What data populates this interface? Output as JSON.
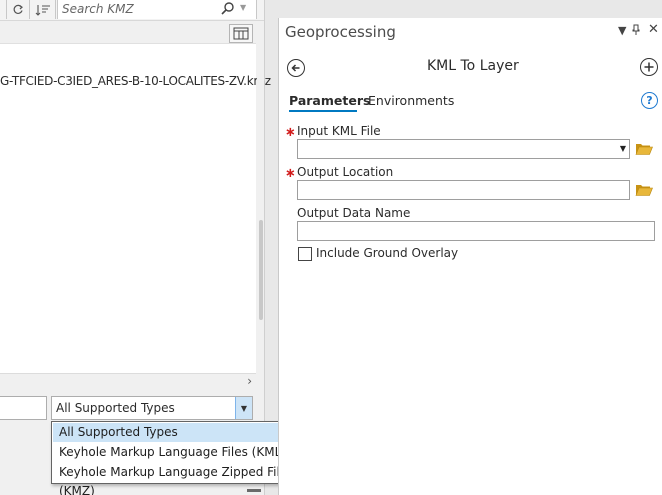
{
  "file_dialog": {
    "search_placeholder": "Search KMZ",
    "file_name": "G-TFCIED-C3IED_ARES-B-10-LOCALITES-ZV.kmz",
    "type_selected": "All Supported Types",
    "type_options": [
      "All Supported Types",
      "Keyhole Markup Language Files (KML)",
      "Keyhole Markup Language Zipped Files (KMZ)"
    ]
  },
  "geoprocessing": {
    "pane_title": "Geoprocessing",
    "tool_title": "KML To Layer",
    "tabs": [
      {
        "label": "Parameters",
        "active": true
      },
      {
        "label": "Environments",
        "active": false
      }
    ],
    "params": {
      "input_kml": {
        "label": "Input KML File",
        "required": true,
        "value": ""
      },
      "output_location": {
        "label": "Output Location",
        "required": true,
        "value": ""
      },
      "output_name": {
        "label": "Output Data Name",
        "required": false,
        "value": ""
      }
    },
    "include_ground_overlay": {
      "label": "Include Ground Overlay",
      "checked": false
    }
  },
  "colors": {
    "accent": "#0079c1",
    "required": "#d11b1b",
    "folder": "#d9a520",
    "selection": "#cce4f7"
  }
}
